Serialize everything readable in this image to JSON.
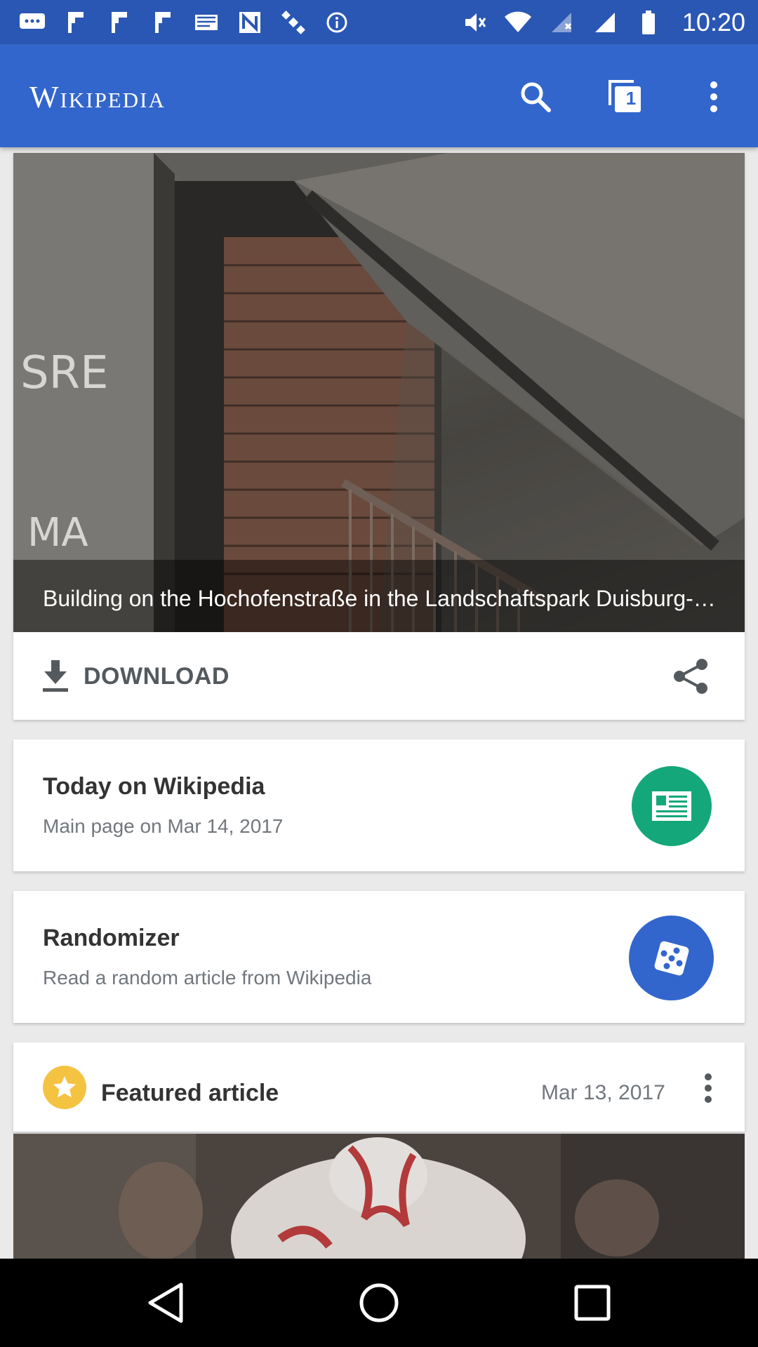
{
  "status_bar": {
    "time": "10:20",
    "left_icons": [
      "messages-icon",
      "flipboard-icon",
      "flipboard-icon",
      "flipboard-icon",
      "email-icon",
      "news-icon",
      "satellite-icon",
      "info-icon"
    ],
    "right_icons": [
      "mute-icon",
      "wifi-icon",
      "no-sim-icon",
      "signal-icon",
      "battery-icon"
    ]
  },
  "app_bar": {
    "logo": "Wikipedia",
    "tabs_count": "1",
    "color": "#3366cc"
  },
  "picture_of_day": {
    "caption": "Building on the Hochofenstraße in the Landschaftspark Duisburg-Nord",
    "download_label": "DOWNLOAD"
  },
  "cards": [
    {
      "title": "Today on Wikipedia",
      "subtitle": "Main page on Mar 14, 2017",
      "icon": "news-icon",
      "icon_color": "#14a77a"
    },
    {
      "title": "Randomizer",
      "subtitle": "Read a random article from Wikipedia",
      "icon": "dice-icon",
      "icon_color": "#3366cc"
    }
  ],
  "featured": {
    "title": "Featured article",
    "date": "Mar 13, 2017",
    "icon": "star-icon",
    "icon_color": "#f5c342"
  }
}
